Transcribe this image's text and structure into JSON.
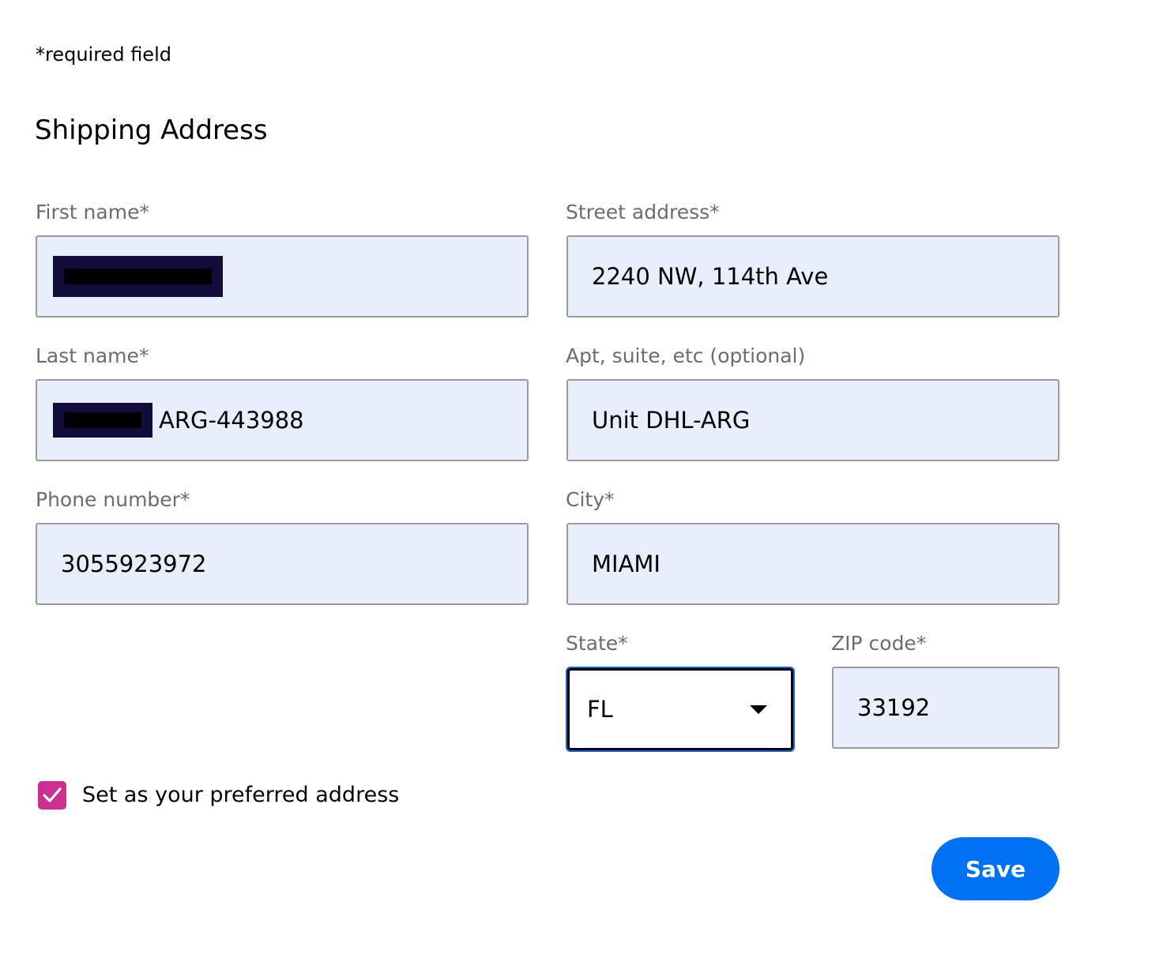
{
  "required_note": "*required field",
  "section_title": "Shipping Address",
  "fields": {
    "first_name": {
      "label": "First name*",
      "value": ""
    },
    "last_name": {
      "label": "Last name*",
      "value": "ARG-443988"
    },
    "phone": {
      "label": "Phone number*",
      "value": "3055923972"
    },
    "street": {
      "label": "Street address*",
      "value": "2240 NW, 114th Ave"
    },
    "apt": {
      "label": "Apt, suite, etc (optional)",
      "value": "Unit DHL-ARG"
    },
    "city": {
      "label": "City*",
      "value": "MIAMI"
    },
    "state": {
      "label": "State*",
      "value": "FL"
    },
    "zip": {
      "label": "ZIP code*",
      "value": "33192"
    }
  },
  "preferred": {
    "label": "Set as your preferred address",
    "checked": true
  },
  "save_label": "Save",
  "colors": {
    "field_bg": "#e8eefc",
    "checkbox": "#cb2f8f",
    "primary": "#0071f2",
    "focus_ring": "#1f5fc7",
    "redaction": "#120c3a"
  },
  "icons": {
    "dropdown": "caret-down-icon",
    "checkbox": "checkmark-icon"
  }
}
